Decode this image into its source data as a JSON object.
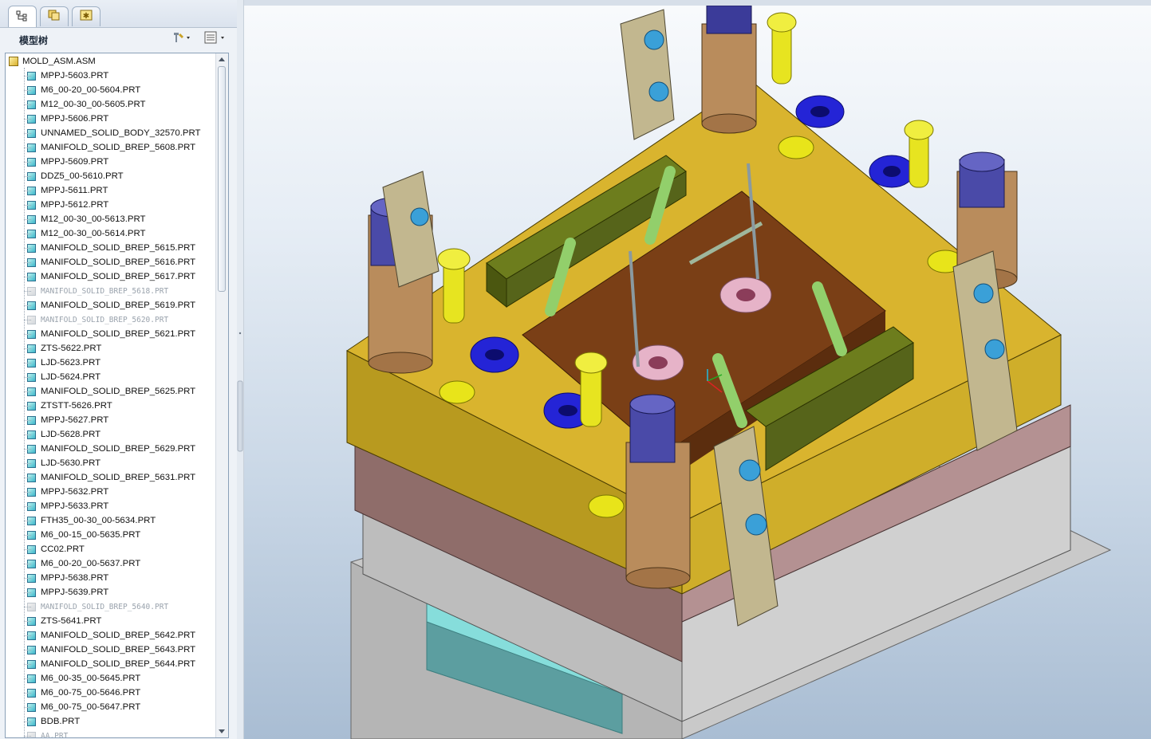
{
  "tabs": [
    {
      "name": "model-tree-tab",
      "icon": "model-tree-icon",
      "active": true
    },
    {
      "name": "folder-browser-tab",
      "icon": "folder-icon",
      "active": false
    },
    {
      "name": "favorites-tab",
      "icon": "favorites-icon",
      "active": false
    }
  ],
  "tree": {
    "title": "模型树",
    "settings_icon": "tree-settings-icon",
    "columns_icon": "tree-columns-icon",
    "root": "MOLD_ASM.ASM",
    "items": [
      {
        "label": "MPPJ-5603.PRT",
        "suppressed": false
      },
      {
        "label": "M6_00-20_00-5604.PRT",
        "suppressed": false
      },
      {
        "label": "M12_00-30_00-5605.PRT",
        "suppressed": false
      },
      {
        "label": "MPPJ-5606.PRT",
        "suppressed": false
      },
      {
        "label": "UNNAMED_SOLID_BODY_32570.PRT",
        "suppressed": false
      },
      {
        "label": "MANIFOLD_SOLID_BREP_5608.PRT",
        "suppressed": false
      },
      {
        "label": "MPPJ-5609.PRT",
        "suppressed": false
      },
      {
        "label": "DDZ5_00-5610.PRT",
        "suppressed": false
      },
      {
        "label": "MPPJ-5611.PRT",
        "suppressed": false
      },
      {
        "label": "MPPJ-5612.PRT",
        "suppressed": false
      },
      {
        "label": "M12_00-30_00-5613.PRT",
        "suppressed": false
      },
      {
        "label": "M12_00-30_00-5614.PRT",
        "suppressed": false
      },
      {
        "label": "MANIFOLD_SOLID_BREP_5615.PRT",
        "suppressed": false
      },
      {
        "label": "MANIFOLD_SOLID_BREP_5616.PRT",
        "suppressed": false
      },
      {
        "label": "MANIFOLD_SOLID_BREP_5617.PRT",
        "suppressed": false
      },
      {
        "label": "MANIFOLD_SOLID_BREP_5618.PRT",
        "suppressed": true
      },
      {
        "label": "MANIFOLD_SOLID_BREP_5619.PRT",
        "suppressed": false
      },
      {
        "label": "MANIFOLD_SOLID_BREP_5620.PRT",
        "suppressed": true
      },
      {
        "label": "MANIFOLD_SOLID_BREP_5621.PRT",
        "suppressed": false
      },
      {
        "label": "ZTS-5622.PRT",
        "suppressed": false
      },
      {
        "label": "LJD-5623.PRT",
        "suppressed": false
      },
      {
        "label": "LJD-5624.PRT",
        "suppressed": false
      },
      {
        "label": "MANIFOLD_SOLID_BREP_5625.PRT",
        "suppressed": false
      },
      {
        "label": "ZTSTT-5626.PRT",
        "suppressed": false
      },
      {
        "label": "MPPJ-5627.PRT",
        "suppressed": false
      },
      {
        "label": "LJD-5628.PRT",
        "suppressed": false
      },
      {
        "label": "MANIFOLD_SOLID_BREP_5629.PRT",
        "suppressed": false
      },
      {
        "label": "LJD-5630.PRT",
        "suppressed": false
      },
      {
        "label": "MANIFOLD_SOLID_BREP_5631.PRT",
        "suppressed": false
      },
      {
        "label": "MPPJ-5632.PRT",
        "suppressed": false
      },
      {
        "label": "MPPJ-5633.PRT",
        "suppressed": false
      },
      {
        "label": "FTH35_00-30_00-5634.PRT",
        "suppressed": false
      },
      {
        "label": "M6_00-15_00-5635.PRT",
        "suppressed": false
      },
      {
        "label": "CC02.PRT",
        "suppressed": false
      },
      {
        "label": "M6_00-20_00-5637.PRT",
        "suppressed": false
      },
      {
        "label": "MPPJ-5638.PRT",
        "suppressed": false
      },
      {
        "label": "MPPJ-5639.PRT",
        "suppressed": false
      },
      {
        "label": "MANIFOLD_SOLID_BREP_5640.PRT",
        "suppressed": true
      },
      {
        "label": "ZTS-5641.PRT",
        "suppressed": false
      },
      {
        "label": "MANIFOLD_SOLID_BREP_5642.PRT",
        "suppressed": false
      },
      {
        "label": "MANIFOLD_SOLID_BREP_5643.PRT",
        "suppressed": false
      },
      {
        "label": "MANIFOLD_SOLID_BREP_5644.PRT",
        "suppressed": false
      },
      {
        "label": "M6_00-35_00-5645.PRT",
        "suppressed": false
      },
      {
        "label": "M6_00-75_00-5646.PRT",
        "suppressed": false
      },
      {
        "label": "M6_00-75_00-5647.PRT",
        "suppressed": false
      },
      {
        "label": "BDB.PRT",
        "suppressed": false
      },
      {
        "label": "AA.PRT",
        "suppressed": true
      }
    ]
  },
  "viewport": {
    "content": "mold-assembly-3d-model",
    "colors": {
      "plate": "#d9b42e",
      "cavity": "#7a3f16",
      "rail": "#5f6f18",
      "spring": "#2a2ad8",
      "screw": "#e7e420",
      "bushing": "#b98c5c",
      "pin": "#93d070",
      "support": "#c2b78f"
    }
  }
}
